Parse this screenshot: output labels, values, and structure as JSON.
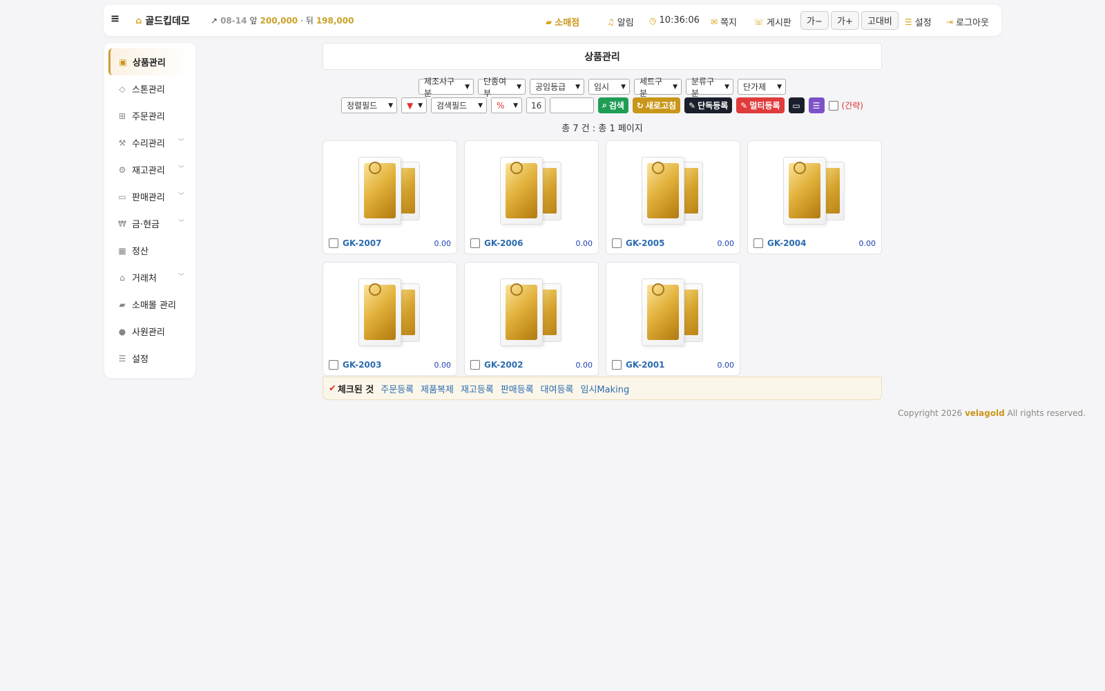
{
  "topbar": {
    "menu_icon": "hamburger-icon",
    "brand": "골드킵데모",
    "price_date": "08-14",
    "price_front_label": "앞",
    "price_front": "200,000",
    "price_sep": "· 뒤",
    "price_back": "198,000",
    "store": "소매점",
    "alarm": "알림",
    "clock": "10:36:06",
    "message": "쪽지",
    "board": "게시판",
    "font_minus": "가−",
    "font_plus": "가+",
    "contrast": "고대비",
    "settings": "설정",
    "logout": "로그아웃"
  },
  "sidebar": {
    "items": [
      {
        "label": "상품관리",
        "icon": "image-icon"
      },
      {
        "label": "스톤관리",
        "icon": "diamond-icon"
      },
      {
        "label": "주문관리",
        "icon": "cart-icon"
      },
      {
        "label": "수리관리",
        "icon": "wrench-icon"
      },
      {
        "label": "재고관리",
        "icon": "cubes-icon"
      },
      {
        "label": "판매관리",
        "icon": "card-icon"
      },
      {
        "label": "금·현금",
        "icon": "won-icon"
      },
      {
        "label": "정산",
        "icon": "calculator-icon"
      },
      {
        "label": "거래처",
        "icon": "bank-icon"
      },
      {
        "label": "소매몰 관리",
        "icon": "shopping-bag-icon"
      },
      {
        "label": "사원관리",
        "icon": "user-icon"
      },
      {
        "label": "설정",
        "icon": "sliders-icon"
      }
    ]
  },
  "page": {
    "title": "상품관리"
  },
  "filters": {
    "maker": "제조사구분",
    "discontinued": "단종여부",
    "grade": "공임등급",
    "temp": "임시",
    "set": "세트구분",
    "category": "분류구분",
    "unit_price": "단가제",
    "sort_field": "정렬필드",
    "sort_dir": "▼",
    "search_field": "검색필드",
    "match": "%",
    "page_size": "16",
    "search_value": "",
    "search_btn": "검색",
    "refresh_btn": "새로고침",
    "single_btn": "단독등록",
    "multi_btn": "멀티등록",
    "simple_label": "(간략)"
  },
  "summary": "총 7 건 : 총 1 페이지",
  "products": [
    {
      "code": "GK-2007",
      "price": "0.00"
    },
    {
      "code": "GK-2006",
      "price": "0.00"
    },
    {
      "code": "GK-2005",
      "price": "0.00"
    },
    {
      "code": "GK-2004",
      "price": "0.00"
    },
    {
      "code": "GK-2003",
      "price": "0.00"
    },
    {
      "code": "GK-2002",
      "price": "0.00"
    },
    {
      "code": "GK-2001",
      "price": "0.00"
    }
  ],
  "actionbar": {
    "label": "체크된 것",
    "actions": [
      "주문등록",
      "제품복제",
      "재고등록",
      "판매등록",
      "대여등록",
      "임시Making"
    ]
  },
  "footer": {
    "prefix": "Copyright 2026",
    "brand": "velagold",
    "suffix": "All rights reserved."
  },
  "colors": {
    "accent": "#c9961a",
    "link": "#2b6cb0",
    "search": "#1f9d55",
    "multi": "#e03b3b"
  }
}
